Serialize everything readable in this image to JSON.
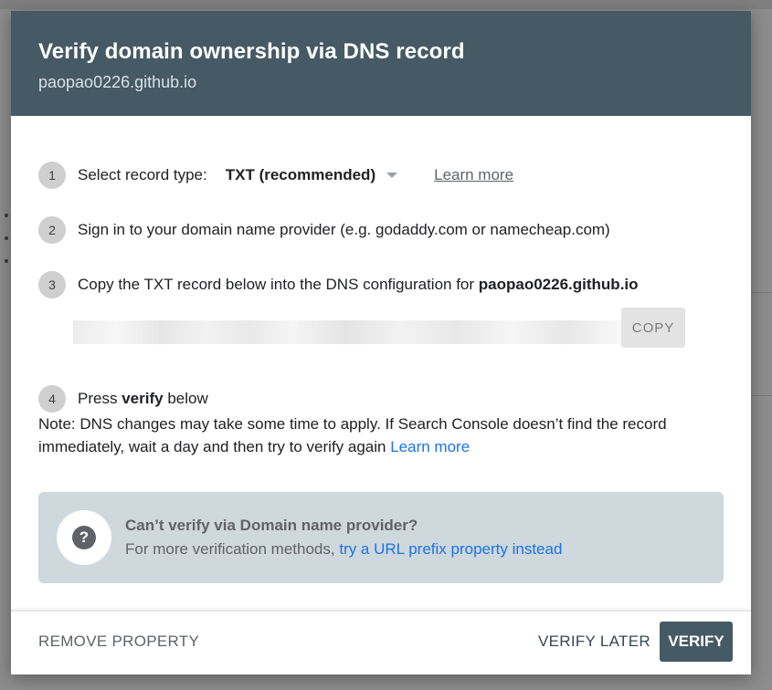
{
  "dialog": {
    "title": "Verify domain ownership via DNS record",
    "subtitle": "paopao0226.github.io"
  },
  "steps": [
    {
      "number": "1",
      "label": "Select record type:",
      "select_value": "TXT (recommended)",
      "link": "Learn more"
    },
    {
      "number": "2",
      "label": "Sign in to your domain name provider (e.g. godaddy.com or namecheap.com)"
    },
    {
      "number": "3",
      "label": "Copy the TXT record below into the DNS configuration for",
      "domain": "paopao0226.github.io"
    },
    {
      "number": "4",
      "label_prefix": "Press",
      "label_bold": "verify",
      "label_suffix": "below"
    }
  ],
  "record": {
    "copy_label": "COPY"
  },
  "note": {
    "text": "Note: DNS changes may take some time to apply. If Search Console doesn’t find the record immediately, wait a day and then try to verify again",
    "link": "Learn more"
  },
  "alternative": {
    "icon": "help-icon",
    "icon_glyph": "?",
    "title": "Can’t verify via Domain name provider?",
    "text": "For more verification methods,",
    "link": "try a URL prefix property instead"
  },
  "footer": {
    "remove_label": "REMOVE PROPERTY",
    "later_label": "VERIFY LATER",
    "verify_label": "VERIFY"
  },
  "colors": {
    "header_bg": "#455a64",
    "link_blue": "#1a73e8",
    "alt_box_bg": "#cfd8dc"
  }
}
